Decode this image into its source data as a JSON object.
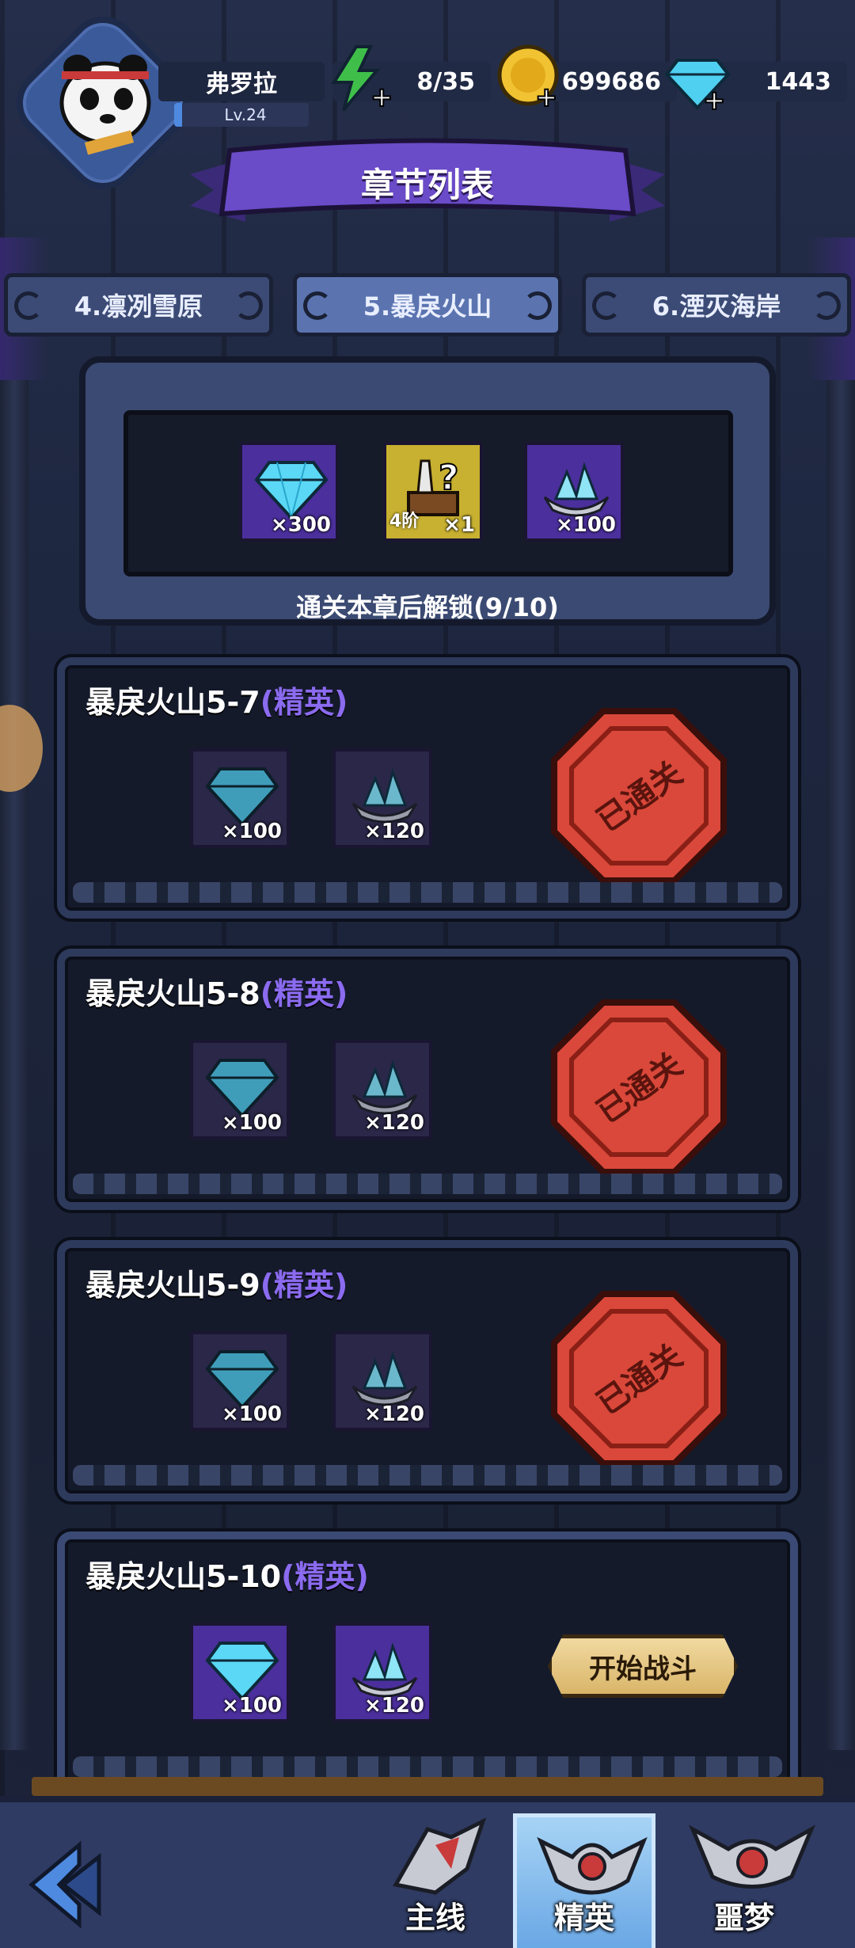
{
  "player": {
    "name": "弗罗拉",
    "level": "Lv.24"
  },
  "resources": {
    "energy": "8/35",
    "gold": "699686",
    "diamonds": "1443"
  },
  "title": "章节列表",
  "chapter_tabs": [
    {
      "label": "4.凛冽雪原",
      "active": false
    },
    {
      "label": "5.暴戾火山",
      "active": true
    },
    {
      "label": "6.湮灭海岸",
      "active": false
    }
  ],
  "chapter_reward": {
    "items": [
      {
        "icon": "diamond-icon",
        "qty": "×300"
      },
      {
        "icon": "mystery-weapon-chest-icon",
        "tier": "4阶",
        "qty": "×1"
      },
      {
        "icon": "crystal-ore-icon",
        "qty": "×100"
      }
    ],
    "unlock_text": "通关本章后解锁(9/10)"
  },
  "stages": [
    {
      "name": "暴戾火山5-7",
      "tag": "(精英)",
      "rewards": [
        {
          "icon": "diamond-icon",
          "qty": "×100"
        },
        {
          "icon": "crystal-ore-icon",
          "qty": "×120"
        }
      ],
      "status": "cleared",
      "stamp_text": "已通关"
    },
    {
      "name": "暴戾火山5-8",
      "tag": "(精英)",
      "rewards": [
        {
          "icon": "diamond-icon",
          "qty": "×100"
        },
        {
          "icon": "crystal-ore-icon",
          "qty": "×120"
        }
      ],
      "status": "cleared",
      "stamp_text": "已通关"
    },
    {
      "name": "暴戾火山5-9",
      "tag": "(精英)",
      "rewards": [
        {
          "icon": "diamond-icon",
          "qty": "×100"
        },
        {
          "icon": "crystal-ore-icon",
          "qty": "×120"
        }
      ],
      "status": "cleared",
      "stamp_text": "已通关"
    },
    {
      "name": "暴戾火山5-10",
      "tag": "(精英)",
      "rewards": [
        {
          "icon": "diamond-icon",
          "qty": "×100"
        },
        {
          "icon": "crystal-ore-icon",
          "qty": "×120"
        }
      ],
      "status": "available",
      "button_label": "开始战斗"
    }
  ],
  "bottom_nav": [
    {
      "label": "主线",
      "active": false
    },
    {
      "label": "精英",
      "active": true
    },
    {
      "label": "噩梦",
      "active": false
    }
  ],
  "colors": {
    "elite_tag": "#8b6bf0",
    "stamp_red": "#d9483a",
    "start_button": "#e6c47f",
    "active_nav": "#8fc2ef"
  }
}
